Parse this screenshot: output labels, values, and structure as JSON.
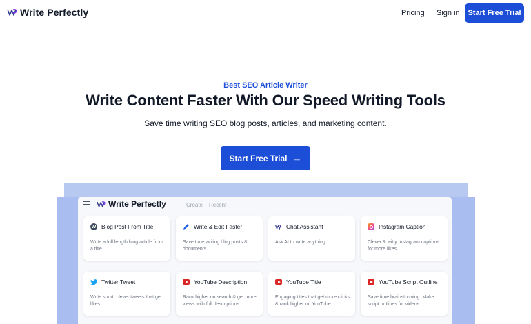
{
  "nav": {
    "brand": "Write Perfectly",
    "pricing": "Pricing",
    "sign_in": "Sign in",
    "cta": "Start Free Trial"
  },
  "hero": {
    "eyebrow": "Best SEO Article Writer",
    "title": "Write Content Faster With Our Speed Writing Tools",
    "subtitle": "Save time writing SEO blog posts, articles, and marketing content.",
    "cta": "Start Free Trial",
    "cta_icon": "arrow-right-icon"
  },
  "mockup": {
    "brand": "Write Perfectly",
    "menu": [
      "Create",
      "Recent"
    ],
    "cards": [
      {
        "icon": "wordpress-icon",
        "title": "Blog Post From Title",
        "desc": "Write a full length blog article from a title"
      },
      {
        "icon": "pencil-icon",
        "title": "Write & Edit Faster",
        "desc": "Save time writing blog posts & documents"
      },
      {
        "icon": "write-perfectly-logo-icon",
        "title": "Chat Assistant",
        "desc": "Ask AI to write anything"
      },
      {
        "icon": "instagram-icon",
        "title": "Instagram Caption",
        "desc": "Clever & witty Instagram captions for more likes"
      },
      {
        "icon": "twitter-icon",
        "title": "Twitter Tweet",
        "desc": "Write short, clever tweets that get likes"
      },
      {
        "icon": "youtube-icon",
        "title": "YouTube Description",
        "desc": "Rank higher on search & get more views with full descriptions"
      },
      {
        "icon": "youtube-icon",
        "title": "YouTube Title",
        "desc": "Engaging titles that get more clicks & rank higher on YouTube"
      },
      {
        "icon": "youtube-icon",
        "title": "YouTube Script Outline",
        "desc": "Save time brainstorming. Make script outlines for videos"
      }
    ]
  },
  "colors": {
    "primary": "#1d4ed8",
    "mockup_frame": "#a9bdf0",
    "youtube": "#dc2626",
    "twitter": "#1da1f2"
  }
}
